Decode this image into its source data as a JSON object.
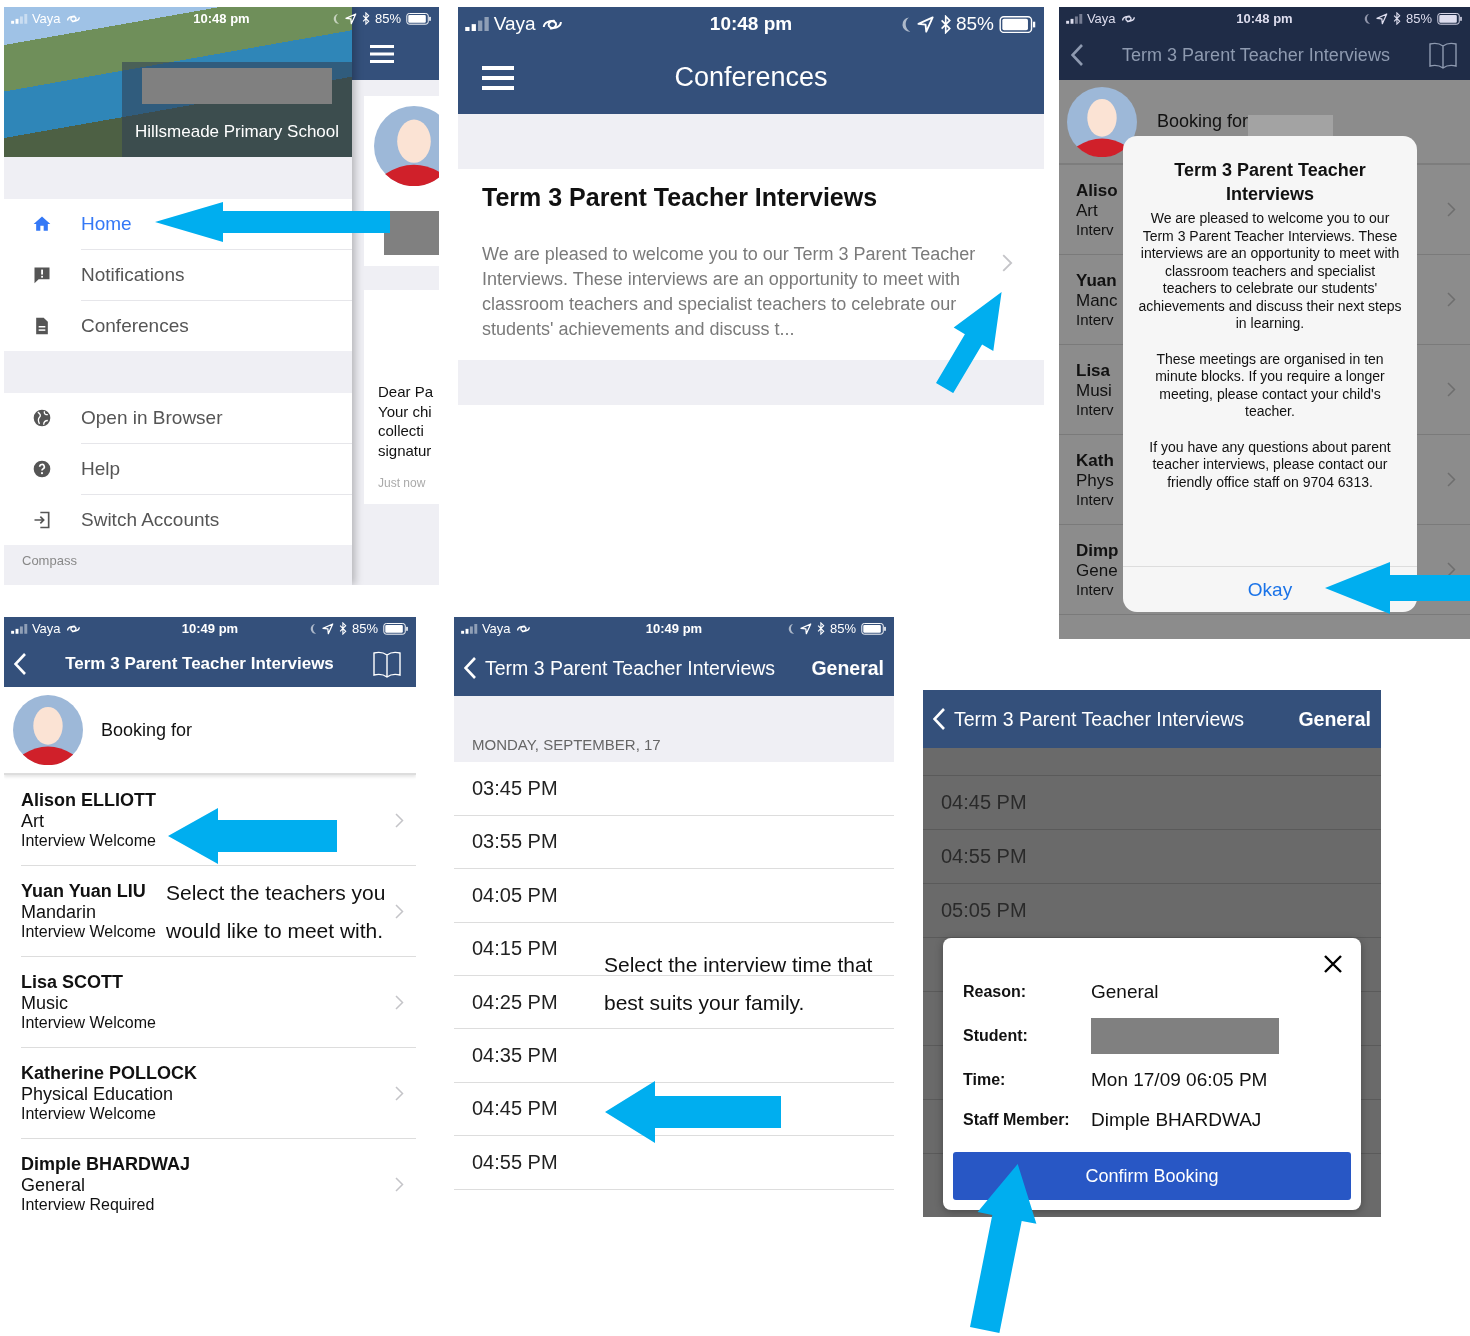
{
  "panels": [
    {
      "kind": "menu",
      "status": {
        "carrier": "Vaya",
        "time": "10:48 pm",
        "battery": "85%"
      },
      "school": "Hillsmeade Primary School",
      "menu_groups": [
        {
          "items": [
            {
              "label": "Home",
              "selected": true
            },
            {
              "label": "Notifications",
              "selected": false
            },
            {
              "label": "Conferences",
              "selected": false
            }
          ]
        },
        {
          "items": [
            {
              "label": "Open in Browser",
              "selected": false
            },
            {
              "label": "Help",
              "selected": false
            },
            {
              "label": "Switch Accounts",
              "selected": false
            }
          ]
        }
      ],
      "section_header": "Compass",
      "behind_card": {
        "lines": [
          "Dear Pa",
          "Your chi",
          "collecti",
          "signatur"
        ],
        "time": "Just now"
      }
    },
    {
      "kind": "conferences",
      "status": {
        "carrier": "Vaya",
        "time": "10:48 pm",
        "battery": "85%"
      },
      "title": "Conferences",
      "card": {
        "title": "Term 3 Parent Teacher Interviews",
        "body": "We are pleased to welcome you to our Term 3 Parent Teacher Interviews. These interviews are an opportunity to meet with classroom teachers and specialist teachers to celebrate our students' achievements and discuss t..."
      }
    },
    {
      "kind": "alert",
      "status": {
        "carrier": "Vaya",
        "time": "10:48 pm",
        "battery": "85%"
      },
      "nav_title": "Term 3 Parent Teacher Interviews",
      "booking_label": "Booking for",
      "rows": [
        {
          "name": "Aliso",
          "subject": "Art",
          "status": "Interv"
        },
        {
          "name": "Yuan",
          "subject": "Manc",
          "status": "Interv"
        },
        {
          "name": "Lisa",
          "subject": "Musi",
          "status": "Interv"
        },
        {
          "name": "Kath",
          "subject": "Phys",
          "status": "Interv"
        },
        {
          "name": "Dimp",
          "subject": "Gene",
          "status": "Interv"
        }
      ],
      "alert": {
        "title": "Term 3 Parent Teacher Interviews",
        "paragraphs": [
          "We are pleased to welcome you to our Term 3 Parent Teacher Interviews. These interviews are an opportunity to meet with classroom teachers and specialist teachers to celebrate our students' achievements and discuss their next steps in learning.",
          "These meetings are organised in ten minute blocks. If you require a longer meeting, please contact your child's teacher.",
          "If you have any questions about parent teacher interviews, please contact our friendly office staff on 9704 6313."
        ],
        "button": "Okay"
      }
    },
    {
      "kind": "teachers",
      "status": {
        "carrier": "Vaya",
        "time": "10:49 pm",
        "battery": "85%"
      },
      "nav_title": "Term 3 Parent Teacher Interviews",
      "booking_label": "Booking for",
      "teachers": [
        {
          "name": "Alison ELLIOTT",
          "subject": "Art",
          "status": "Interview Welcome"
        },
        {
          "name": "Yuan Yuan LIU",
          "subject": "Mandarin",
          "status": "Interview Welcome"
        },
        {
          "name": "Lisa SCOTT",
          "subject": "Music",
          "status": "Interview Welcome"
        },
        {
          "name": "Katherine POLLOCK",
          "subject": "Physical Education",
          "status": "Interview Welcome"
        },
        {
          "name": "Dimple BHARDWAJ",
          "subject": "General",
          "status": "Interview Required"
        }
      ]
    },
    {
      "kind": "times",
      "status": {
        "carrier": "Vaya",
        "time": "10:49 pm",
        "battery": "85%"
      },
      "nav_title": "Term 3 Parent Teacher Interviews",
      "nav_right": "General",
      "date_header": "MONDAY, SEPTEMBER, 17",
      "times": [
        "03:45 PM",
        "03:55 PM",
        "04:05 PM",
        "04:15 PM",
        "04:25 PM",
        "04:35 PM",
        "04:45 PM",
        "04:55 PM"
      ]
    },
    {
      "kind": "confirm",
      "nav_title": "Term 3 Parent Teacher Interviews",
      "nav_right": "General",
      "times": [
        "04:45 PM",
        "04:55 PM",
        "05:05 PM"
      ],
      "dialog": {
        "rows": [
          {
            "kind": "text",
            "label": "Reason:",
            "value": "General"
          },
          {
            "kind": "redacted",
            "label": "Student:"
          },
          {
            "kind": "text",
            "label": "Time:",
            "value": "Mon 17/09 06:05 PM"
          },
          {
            "kind": "text",
            "label": "Staff Member:",
            "value": "Dimple BHARDWAJ"
          }
        ],
        "button": "Confirm Booking"
      }
    }
  ],
  "callouts": [
    "Select the teachers you would like to meet with.",
    "Select the interview time that best suits your family."
  ]
}
